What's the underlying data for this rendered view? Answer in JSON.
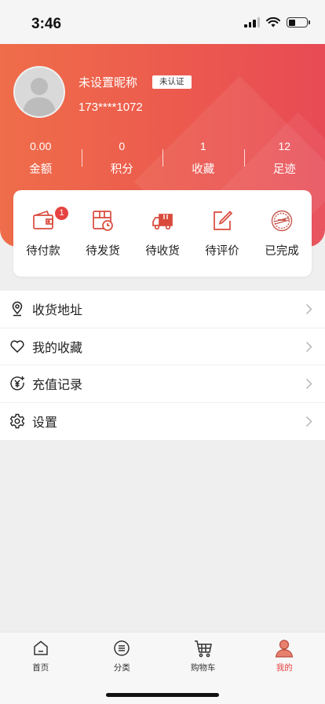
{
  "status_bar": {
    "time": "3:46"
  },
  "profile": {
    "nickname": "未设置昵称",
    "verify_badge": "未认证",
    "phone": "173****1072"
  },
  "stats": [
    {
      "value": "0.00",
      "label": "金额"
    },
    {
      "value": "0",
      "label": "积分"
    },
    {
      "value": "1",
      "label": "收藏"
    },
    {
      "value": "12",
      "label": "足迹"
    }
  ],
  "orders": [
    {
      "label": "待付款",
      "icon": "wallet-icon",
      "badge": "1"
    },
    {
      "label": "待发货",
      "icon": "package-clock-icon"
    },
    {
      "label": "待收货",
      "icon": "truck-icon"
    },
    {
      "label": "待评价",
      "icon": "edit-icon"
    },
    {
      "label": "已完成",
      "icon": "stamp-icon"
    }
  ],
  "menu": [
    {
      "label": "收货地址",
      "icon": "location-pin-icon"
    },
    {
      "label": "我的收藏",
      "icon": "heart-icon"
    },
    {
      "label": "充值记录",
      "icon": "yuan-plus-icon"
    },
    {
      "label": "设置",
      "icon": "gear-icon"
    }
  ],
  "tabbar": [
    {
      "label": "首页",
      "icon": "home-icon"
    },
    {
      "label": "分类",
      "icon": "list-icon"
    },
    {
      "label": "购物车",
      "icon": "cart-icon"
    },
    {
      "label": "我的",
      "icon": "user-icon",
      "active": true
    }
  ],
  "colors": {
    "accent": "#e64340",
    "header_start": "#ef6d4a",
    "header_end": "#e84a55",
    "background": "#efefef"
  }
}
